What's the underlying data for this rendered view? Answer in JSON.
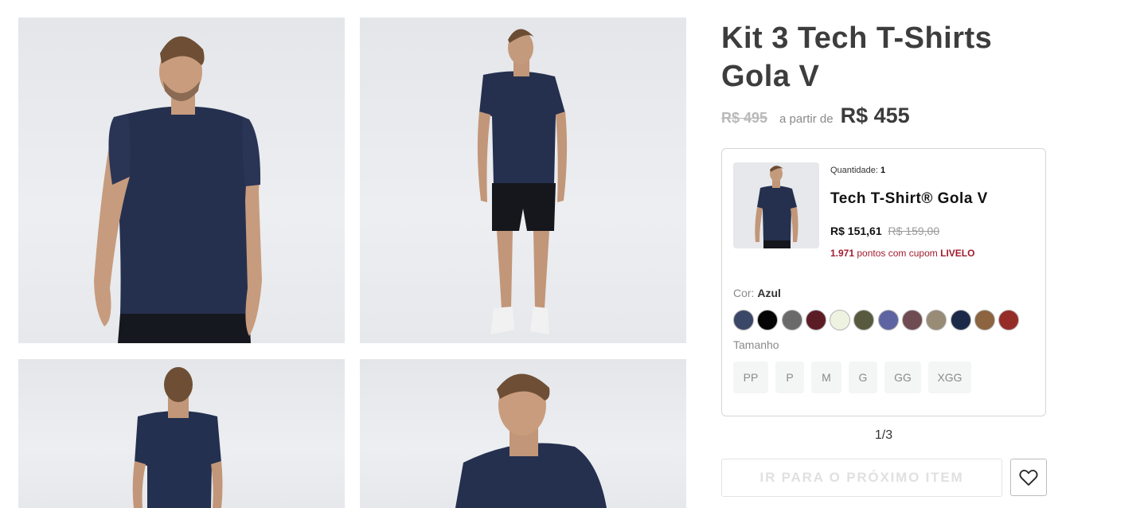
{
  "product": {
    "title": "Kit 3 Tech T-Shirts Gola V",
    "old_price": "R$ 495",
    "from_label": "a partir de",
    "price": "R$ 455"
  },
  "gallery": {
    "images": [
      {
        "name": "model-front-close"
      },
      {
        "name": "model-full-body"
      },
      {
        "name": "model-back"
      },
      {
        "name": "model-side"
      }
    ]
  },
  "item": {
    "quantity_label": "Quantidade:",
    "quantity": "1",
    "name": "Tech T-Shirt® Gola V",
    "price": "R$ 151,61",
    "old_price": "R$ 159,00",
    "points_number": "1.971",
    "points_text": "pontos com cupom",
    "coupon": "LIVELO",
    "color_label": "Cor:",
    "color_value": "Azul",
    "colors": [
      "#3a4766",
      "#050505",
      "#6a6a6a",
      "#5c1c26",
      "#eef2e0",
      "#585a40",
      "#5e64a2",
      "#6f4c52",
      "#988c76",
      "#1b2a48",
      "#8c6440",
      "#962c28"
    ],
    "size_label": "Tamanho",
    "sizes": [
      "PP",
      "P",
      "M",
      "G",
      "GG",
      "XGG"
    ]
  },
  "pager": "1/3",
  "next_button": "IR PARA O PRÓXIMO ITEM",
  "icons": {
    "wishlist": "heart-icon"
  }
}
